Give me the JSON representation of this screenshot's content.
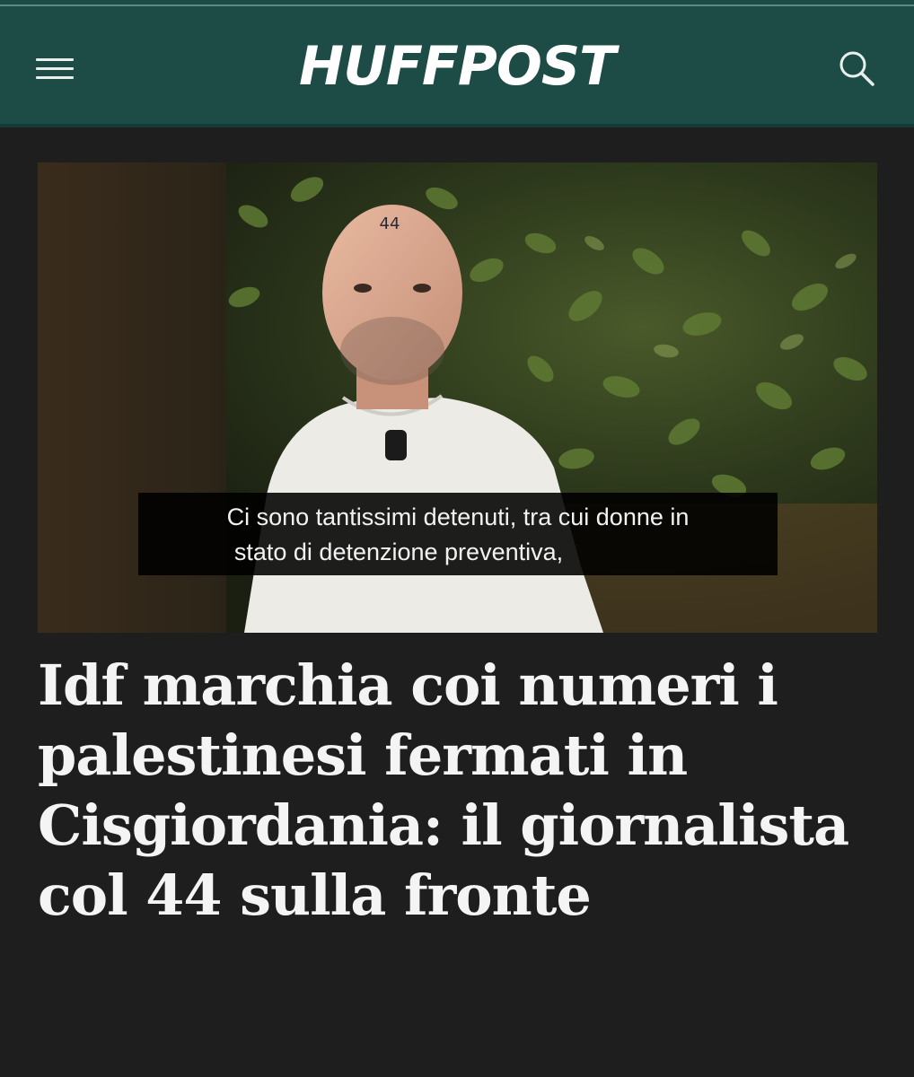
{
  "header": {
    "logo_text": "HUFFPOST",
    "menu_icon": "hamburger-menu-icon",
    "search_icon": "search-icon",
    "background_color": "#1d4b45"
  },
  "hero_image": {
    "forehead_marking": "44",
    "subtitle_line_1": "Ci sono tantissimi detenuti, tra cui donne in",
    "subtitle_line_2": "stato di detenzione preventiva,"
  },
  "article": {
    "headline": "Idf marchia coi numeri i palestinesi fermati in Cisgiordania: il giornalista col 44 sulla fronte"
  }
}
